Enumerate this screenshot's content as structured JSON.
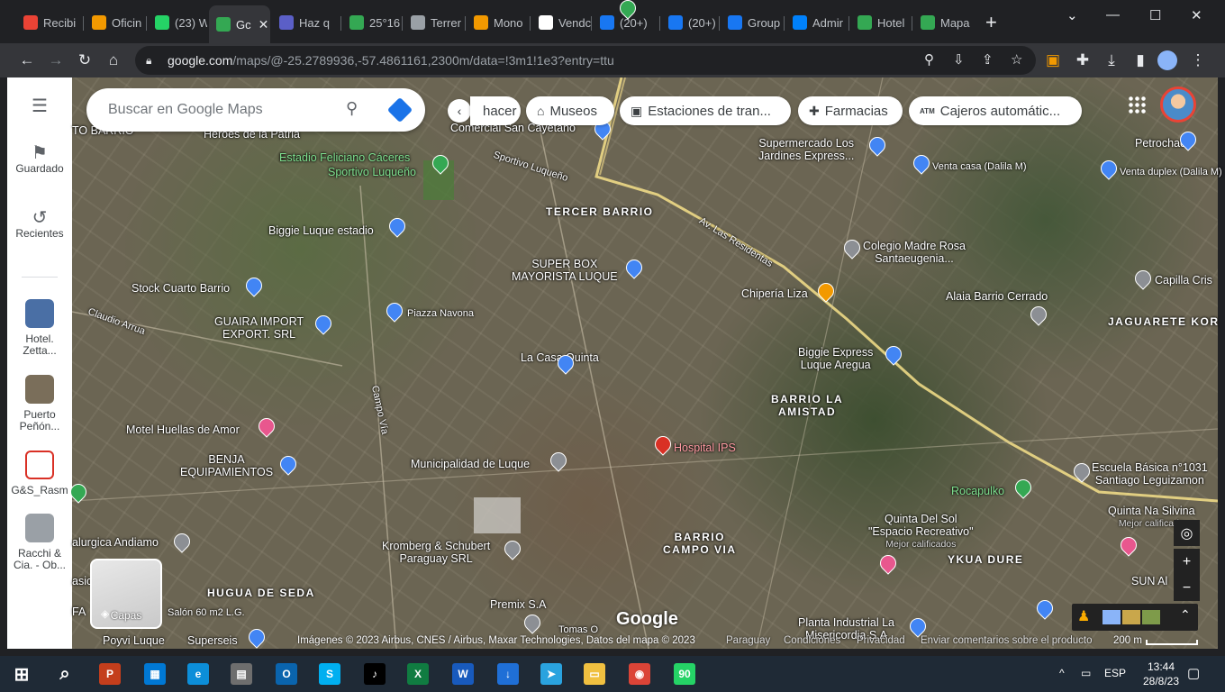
{
  "browser": {
    "tabs": [
      {
        "label": "Recibi",
        "icon": "gmail-icon",
        "color": "#ea4335"
      },
      {
        "label": "Oficin",
        "icon": "h-site-icon",
        "color": "#f29900"
      },
      {
        "label": "(23) W",
        "icon": "whatsapp-icon",
        "color": "#25d366"
      },
      {
        "label": "Gc",
        "icon": "maps-icon",
        "color": "#34a853",
        "active": true
      },
      {
        "label": "Haz q",
        "icon": "teams-icon",
        "color": "#5b5fc7"
      },
      {
        "label": "25°16",
        "icon": "maps-icon",
        "color": "#34a853"
      },
      {
        "label": "Terrer",
        "icon": "globe-icon",
        "color": "#9aa0a6"
      },
      {
        "label": "Mono",
        "icon": "h-site-icon",
        "color": "#f29900"
      },
      {
        "label": "Vendc",
        "icon": "classified-icon",
        "color": "#ffffff"
      },
      {
        "label": "(20+)",
        "icon": "facebook-icon",
        "color": "#1877f2"
      },
      {
        "label": "(20+)",
        "icon": "facebook-icon",
        "color": "#1877f2"
      },
      {
        "label": "Group",
        "icon": "facebook-icon",
        "color": "#1877f2"
      },
      {
        "label": "Admir",
        "icon": "meta-icon",
        "color": "#0081fb"
      },
      {
        "label": "Hotel",
        "icon": "maps-icon",
        "color": "#34a853"
      },
      {
        "label": "Mapa",
        "icon": "green-dot-icon",
        "color": "#34a853"
      }
    ],
    "close_glyph": "✕",
    "new_tab_glyph": "+",
    "window_controls": {
      "chevron": "⌄",
      "minimize": "—",
      "maximize": "☐",
      "close": "✕"
    },
    "url_host": "google.com",
    "url_rest": "/maps/@-25.2789936,-57.4861161,2300m/data=!3m1!1e3?entry=ttu"
  },
  "maps": {
    "search_placeholder": "Buscar en Google Maps",
    "rail": [
      {
        "label": "Guardado",
        "icon": "bookmark-icon"
      },
      {
        "label": "Recientes",
        "icon": "history-icon"
      },
      {
        "label": "Hotel. Zetta...",
        "thumb": "#4a6fa5"
      },
      {
        "label": "Puerto Peñón...",
        "thumb": "#7a6e5a"
      },
      {
        "label": "G&S_Rasm",
        "thumb": "#d93025"
      },
      {
        "label": "Racchi & Cia. - Ob...",
        "thumb": "#9aa0a6"
      }
    ],
    "chips": [
      {
        "label": "hacer",
        "icon": ""
      },
      {
        "label": "Museos",
        "icon": "⌂"
      },
      {
        "label": "Estaciones de tran...",
        "icon": "▣"
      },
      {
        "label": "Farmacias",
        "icon": "✚"
      },
      {
        "label": "Cajeros automátic...",
        "icon": "ATM"
      }
    ],
    "layers_label": "Capas",
    "google_logo": "Google",
    "attribution": "Imágenes © 2023 Airbus, CNES / Airbus, Maxar Technologies, Datos del mapa © 2023",
    "footer_links": [
      "Paraguay",
      "Condiciones",
      "Privacidad",
      "Enviar comentarios sobre el producto"
    ],
    "scale": "200 m",
    "labels": {
      "l1": "TO BARRIO",
      "l2": "Heroes de la Patria",
      "l3": "Comercial San Cayetano",
      "l4": "Estadio Feliciano Cáceres",
      "l5": "Sportivo Luqueño",
      "l6": "Sportivo Luqueño",
      "l7": "TERCER BARRIO",
      "l8": "Supermercado Los",
      "l8b": "Jardines Express...",
      "l9": "Venta casa (Dalila M)",
      "l10": "Petrochaco",
      "l11": "Venta duplex (Dalila M)",
      "l12": "Biggie Luque estadio",
      "l13": "Av. Las Residentas",
      "l14": "Colegio Madre Rosa",
      "l14b": "Santaeugenia...",
      "l15": "SUPER BOX",
      "l15b": "MAYORISTA LUQUE",
      "l16": "Stock Cuarto Barrio",
      "l17": "Chipería Liza",
      "l18": "Alaia Barrio Cerrado",
      "l19": "Capilla Cris",
      "l20": "JAGUARETE KOR",
      "l21": "Claudio Arrua",
      "l22": "GUAIRA IMPORT",
      "l22b": "EXPORT. SRL",
      "l23": "Piazza Navona",
      "l24": "La Casa Quinta",
      "l25": "Biggie Express",
      "l25b": "Luque Aregua",
      "l26": "BARRIO LA",
      "l26b": "AMISTAD",
      "l27": "Campo Vía",
      "l28": "Motel Huellas de Amor",
      "l29": "Hospital IPS",
      "l30": "BENJA",
      "l30b": "EQUIPAMIENTOS",
      "l31": "Municipalidad de Luque",
      "l32": "Escuela Básica n°1031",
      "l32b": "Santiago Leguizamon",
      "l33": "Rocapulko",
      "l34": "Quinta Na Silvina",
      "l34b": "Mejor calificado",
      "l35": "alurgica Andiamo",
      "l36": "BARRIO",
      "l36b": "CAMPO VIA",
      "l37": "Quinta Del Sol",
      "l37b": "\"Espacio Recreativo\"",
      "l37c": "Mejor calificados",
      "l38": "Kromberg & Schubert",
      "l38b": "Paraguay SRL",
      "l39": "YKUA DURE",
      "l40": "SUN Al",
      "l41": "HUGUA DE SEDA",
      "l42": "Premix S.A",
      "l43": "Salón 60 m2 L.G.",
      "l44": "Poyvi Luque",
      "l45": "Superseis",
      "l46": "Planta Industrial La",
      "l46b": "Misericordia S.A",
      "l47": "Tomas O",
      "l48": "asic",
      "l49": "FA"
    }
  },
  "taskbar": {
    "apps": [
      {
        "name": "start-icon",
        "glyph": "⊞",
        "color": "#1f2a36"
      },
      {
        "name": "search-icon",
        "glyph": "⌕",
        "color": "#1f2a36"
      },
      {
        "name": "powerpoint-icon",
        "glyph": "P",
        "color": "#c43e1c"
      },
      {
        "name": "store-icon",
        "glyph": "▦",
        "color": "#0078d4"
      },
      {
        "name": "edge-icon",
        "glyph": "e",
        "color": "#0c8ed9"
      },
      {
        "name": "calculator-icon",
        "glyph": "▤",
        "color": "#6e6e6e"
      },
      {
        "name": "outlook-icon",
        "glyph": "O",
        "color": "#0a64ad"
      },
      {
        "name": "skype-icon",
        "glyph": "S",
        "color": "#00aff0"
      },
      {
        "name": "tiktok-icon",
        "glyph": "♪",
        "color": "#000000"
      },
      {
        "name": "excel-icon",
        "glyph": "X",
        "color": "#107c41"
      },
      {
        "name": "word-icon",
        "glyph": "W",
        "color": "#185abd"
      },
      {
        "name": "downloads-icon",
        "glyph": "↓",
        "color": "#1f6fd6"
      },
      {
        "name": "telegram-icon",
        "glyph": "➤",
        "color": "#2aa3df"
      },
      {
        "name": "explorer-icon",
        "glyph": "▭",
        "color": "#f0c040"
      },
      {
        "name": "chrome-icon",
        "glyph": "◉",
        "color": "#db4437"
      },
      {
        "name": "whatsapp-icon",
        "glyph": "90",
        "color": "#25d366"
      }
    ],
    "tray_arrow": "^",
    "language": "ESP",
    "time": "13:44",
    "date": "28/8/23"
  }
}
